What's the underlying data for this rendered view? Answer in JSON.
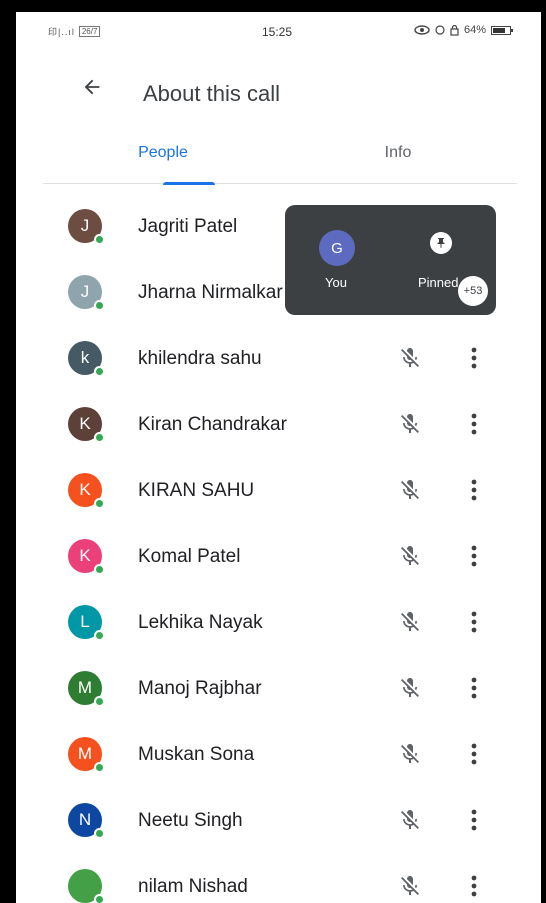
{
  "status_bar": {
    "signal": "印|..ıl",
    "network_badge": "26/7",
    "time": "15:25",
    "battery": "64%"
  },
  "header": {
    "title": "About this call"
  },
  "tabs": [
    {
      "label": "People",
      "active": true
    },
    {
      "label": "Info",
      "active": false
    }
  ],
  "pip": {
    "self_initial": "G",
    "self_label": "You",
    "pinned_label": "Pinned",
    "more_count": "+53"
  },
  "participants": [
    {
      "initial": "J",
      "name": "Jagriti Patel",
      "color": "#6d4c41"
    },
    {
      "initial": "J",
      "name": "Jharna Nirmalkar",
      "color": "#90a4ae"
    },
    {
      "initial": "k",
      "name": "khilendra sahu",
      "color": "#455a64"
    },
    {
      "initial": "K",
      "name": "Kiran Chandrakar",
      "color": "#5d4037"
    },
    {
      "initial": "K",
      "name": "KIRAN SAHU",
      "color": "#f4511e"
    },
    {
      "initial": "K",
      "name": "Komal Patel",
      "color": "#ec407a"
    },
    {
      "initial": "L",
      "name": "Lekhika Nayak",
      "color": "#0097a7"
    },
    {
      "initial": "M",
      "name": "Manoj Rajbhar",
      "color": "#2e7d32"
    },
    {
      "initial": "M",
      "name": "Muskan Sona",
      "color": "#f4511e"
    },
    {
      "initial": "N",
      "name": "Neetu Singh",
      "color": "#0d47a1"
    },
    {
      "initial": "",
      "name": "nilam Nishad",
      "color": "#43a047"
    }
  ],
  "colors": {
    "accent": "#1a73e8",
    "online": "#34a853",
    "pip_bg": "#3c4043"
  }
}
